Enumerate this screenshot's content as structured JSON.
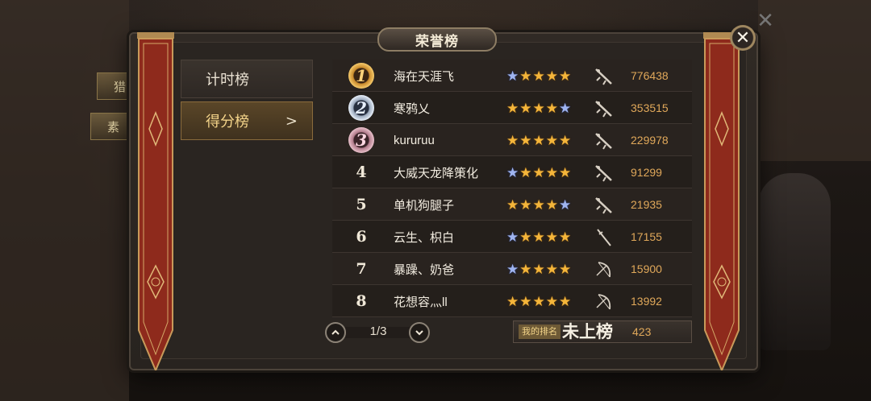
{
  "header": {
    "title": "荣誉榜"
  },
  "background": {
    "tab_top": "猎",
    "tab_bottom": "素"
  },
  "sidebar": {
    "items": [
      {
        "label": "计时榜",
        "active": false
      },
      {
        "label": "得分榜",
        "active": true,
        "arrow": ">"
      }
    ]
  },
  "leaderboard": {
    "rows": [
      {
        "rank": "1",
        "medal": "gold",
        "name": "海在天涯飞",
        "stars": [
          "blue",
          "gold",
          "gold",
          "gold",
          "gold"
        ],
        "weapon": "rifle-icon",
        "score": "776438"
      },
      {
        "rank": "2",
        "medal": "silver",
        "name": "寒鸦乂",
        "stars": [
          "gold",
          "gold",
          "gold",
          "gold",
          "blue"
        ],
        "weapon": "rifle-icon",
        "score": "353515"
      },
      {
        "rank": "3",
        "medal": "bronze",
        "name": "kururuu",
        "stars": [
          "gold",
          "gold",
          "gold",
          "gold",
          "gold"
        ],
        "weapon": "rifle-icon",
        "score": "229978"
      },
      {
        "rank": "4",
        "medal": "",
        "name": "大威天龙降策化",
        "stars": [
          "blue",
          "gold",
          "gold",
          "gold",
          "gold"
        ],
        "weapon": "rifle-icon",
        "score": "91299"
      },
      {
        "rank": "5",
        "medal": "",
        "name": "单机狗腿子",
        "stars": [
          "gold",
          "gold",
          "gold",
          "gold",
          "blue"
        ],
        "weapon": "rifle-icon",
        "score": "21935"
      },
      {
        "rank": "6",
        "medal": "",
        "name": "云生、枳白",
        "stars": [
          "blue",
          "gold",
          "gold",
          "gold",
          "gold"
        ],
        "weapon": "blade-icon",
        "score": "17155"
      },
      {
        "rank": "7",
        "medal": "",
        "name": "暴躁、奶爸",
        "stars": [
          "blue",
          "gold",
          "gold",
          "gold",
          "gold"
        ],
        "weapon": "bow-icon",
        "score": "15900"
      },
      {
        "rank": "8",
        "medal": "",
        "name": "花想容灬ll",
        "stars": [
          "gold",
          "gold",
          "gold",
          "gold",
          "gold"
        ],
        "weapon": "bow-icon",
        "score": "13992"
      }
    ]
  },
  "pager": {
    "text": "1/3",
    "up_icon": "chevron-up-icon",
    "down_icon": "chevron-down-icon"
  },
  "my_rank": {
    "label": "我的排名",
    "value": "未上榜",
    "score": "423"
  },
  "colors": {
    "accent": "#e0a85a",
    "star_gold": "#f4b53a",
    "star_blue": "#9fb4f0",
    "banner_red": "#8e2a1c",
    "active_tab": "#f4d48a"
  }
}
